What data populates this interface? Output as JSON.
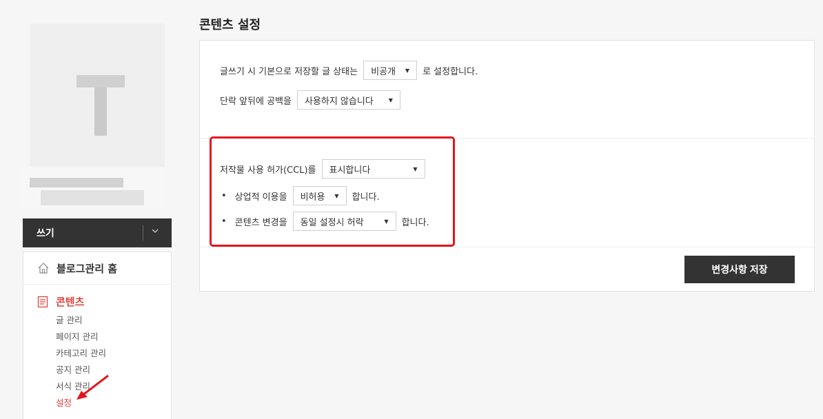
{
  "sidebar": {
    "write_label": "쓰기",
    "menu": {
      "home_label": "블로그관리 홈",
      "content_label": "콘텐츠",
      "items": [
        {
          "label": "글 관리"
        },
        {
          "label": "페이지 관리"
        },
        {
          "label": "카테고리 관리"
        },
        {
          "label": "공지 관리"
        },
        {
          "label": "서식 관리"
        },
        {
          "label": "설정"
        }
      ],
      "active_item": "설정"
    }
  },
  "main": {
    "title": "콘텐츠 설정",
    "default_status": {
      "prefix": "글쓰기 시 기본으로 저장할 글 상태는",
      "value": "비공개",
      "suffix": "로 설정합니다."
    },
    "paragraph_spacing": {
      "prefix": "단락 앞뒤에 공백을",
      "value": "사용하지 않습니다"
    },
    "ccl": {
      "prefix": "저작물 사용 허가(CCL)를",
      "value": "표시합니다"
    },
    "commercial_use": {
      "bullet": "•",
      "prefix": "상업적 이용을",
      "value": "비허용",
      "suffix": "합니다."
    },
    "content_change": {
      "bullet": "•",
      "prefix": "콘텐츠 변경을",
      "value": "동일 설정시 허락",
      "suffix": "합니다."
    },
    "save_label": "변경사항 저장"
  },
  "colors": {
    "accent": "#e0443a",
    "highlight": "#e6141c",
    "button_dark": "#333333"
  },
  "icons": {
    "home": "home-icon",
    "content": "document-icon",
    "write_toggle": "chevron-down-icon",
    "select_caret": "caret-down-icon"
  }
}
